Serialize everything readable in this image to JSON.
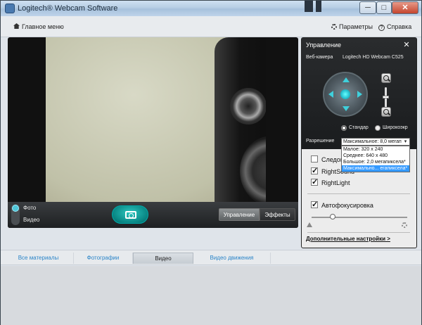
{
  "window": {
    "title": "Logitech® Webcam Software"
  },
  "titlebar_buttons": {
    "minimize": "─",
    "maximize": "□",
    "close": "✕"
  },
  "menu": {
    "home": "Главное меню",
    "params": "Параметры",
    "help": "Справка"
  },
  "capture": {
    "modes": [
      "Фото",
      "Видео"
    ],
    "selected_mode": "Фото",
    "segments": [
      "Управление",
      "Эффекты"
    ],
    "active_segment": "Управление"
  },
  "panel": {
    "title": "Управление",
    "close": "✕",
    "webcam_label": "Веб-камера",
    "webcam_name": "Logitech HD Webcam C525",
    "aspect_options": [
      "Стандар",
      "Широкоэкр"
    ],
    "aspect_selected": "Стандар",
    "resolution_label": "Разрешение",
    "resolution_value": "Максимальное: 8,0 мегап",
    "resolution_options": [
      "Малое: 320 x 240",
      "Среднее: 640 x 480",
      "Большое: 2,0 мегапиксела*",
      "Максимально... егапиксела*"
    ],
    "resolution_highlighted": 3,
    "checkboxes": [
      {
        "label": "Следов",
        "checked": false
      },
      {
        "label": "RightSound",
        "checked": true
      },
      {
        "label": "RightLight",
        "checked": true
      }
    ],
    "autofocus": {
      "label": "Автофокусировка",
      "checked": true
    },
    "focus_level": 0.22,
    "advanced_link": "Дополнительные настройки >"
  },
  "tabs": {
    "items": [
      "Все материалы",
      "Фотографии",
      "Видео",
      "Видео движения"
    ],
    "active": "Видео"
  }
}
